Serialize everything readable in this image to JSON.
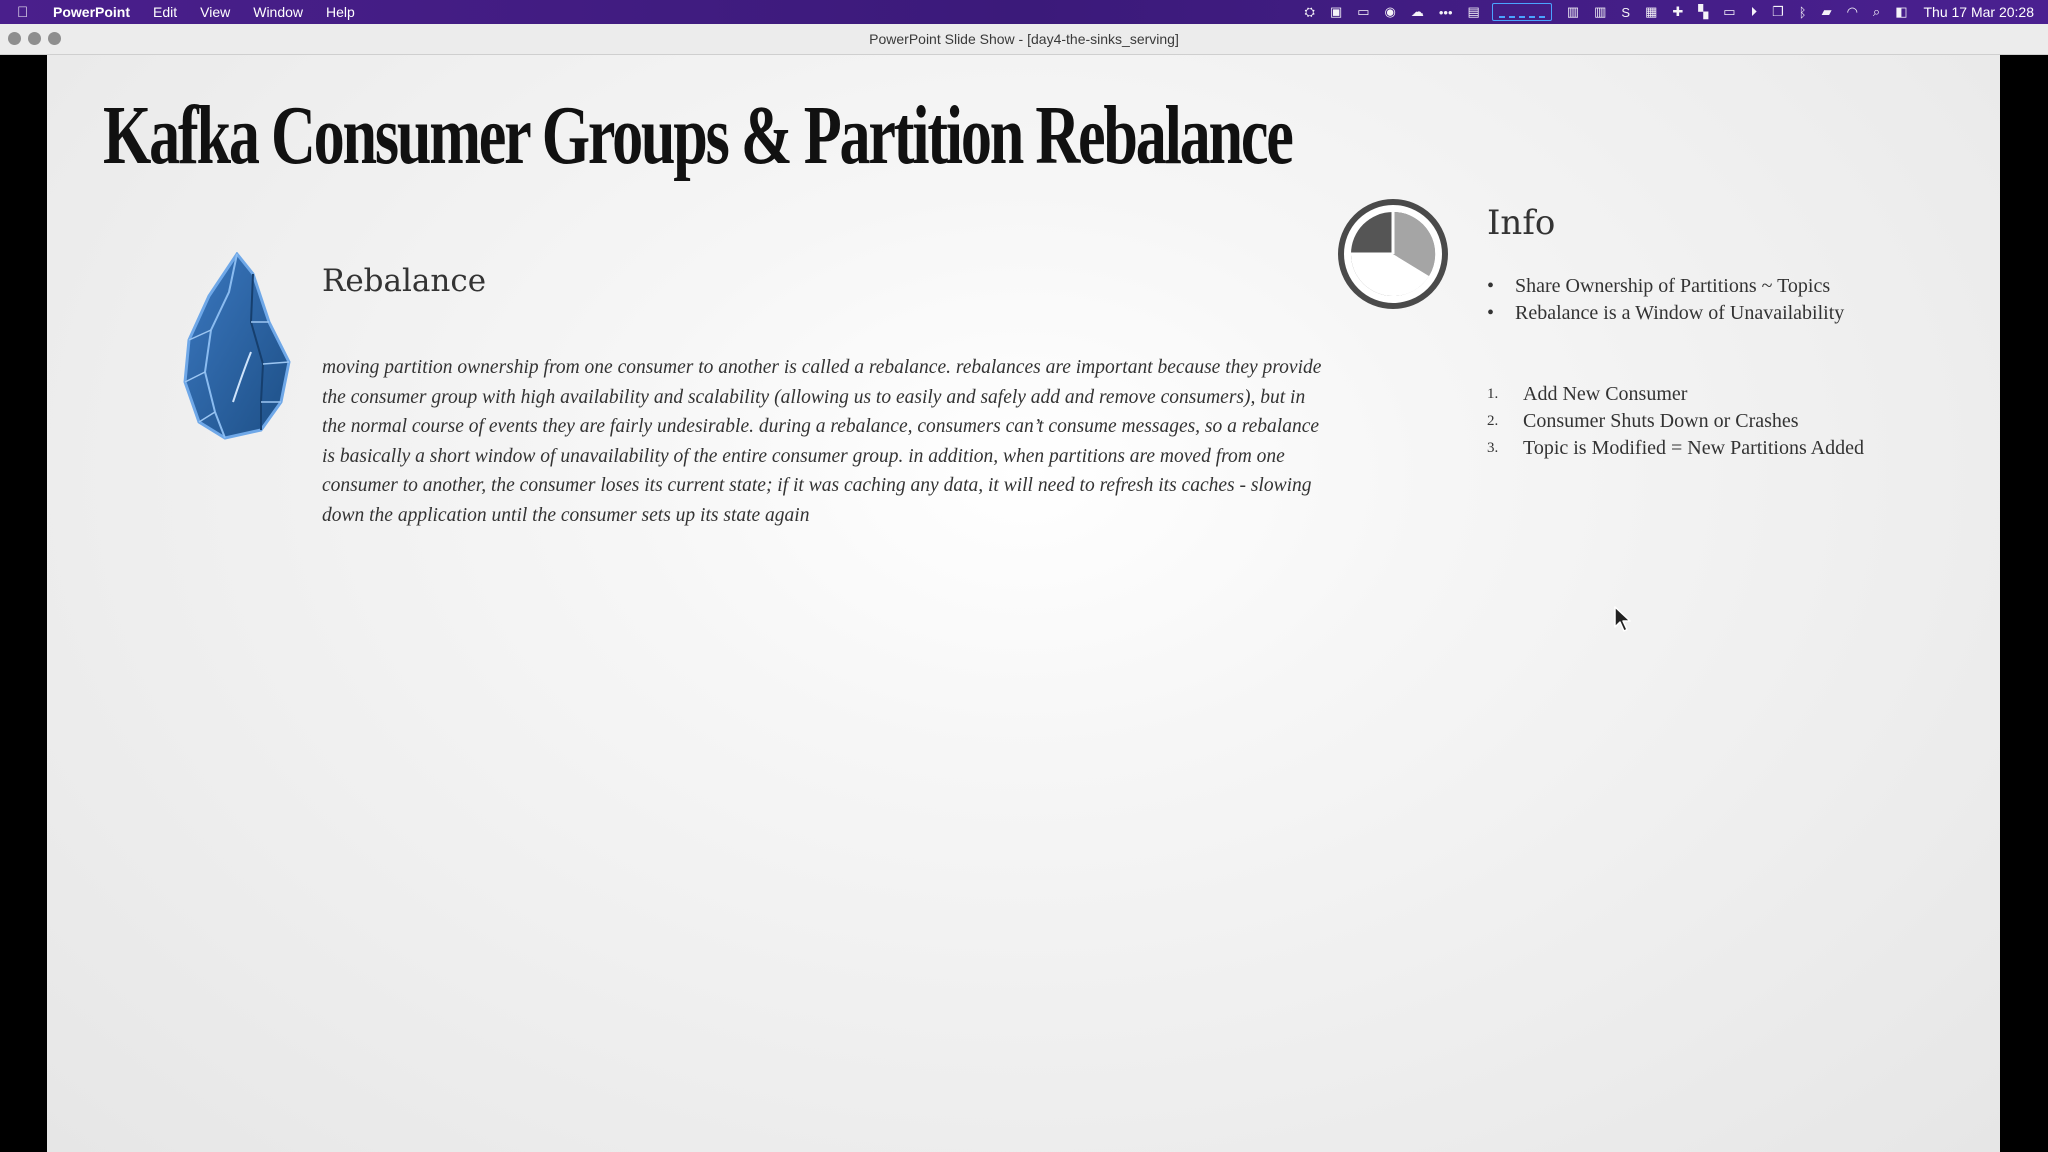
{
  "menubar": {
    "app_name": "PowerPoint",
    "items": [
      "Edit",
      "View",
      "Window",
      "Help"
    ],
    "clock": "Thu 17 Mar  20:28"
  },
  "window": {
    "title": "PowerPoint Slide Show - [day4-the-sinks_serving]"
  },
  "slide": {
    "title": "Kafka Consumer Groups & Partition Rebalance",
    "section_heading": "Rebalance",
    "paragraph": "moving partition ownership from one consumer to another is called a rebalance. rebalances are important because they provide the consumer group with high availability and scalability (allowing us to easily and safely add and remove consumers), but in the normal course of events they are fairly undesirable. during a rebalance, consumers can’t consume messages, so a rebalance is basically a short window of unavailability of the entire consumer group. in addition, when partitions are moved from one consumer to another, the consumer loses its current state; if it was caching any data, it will need to refresh its caches - slowing down the application until the consumer sets up its state again",
    "info_heading": "Info",
    "bullets": [
      "Share Ownership of Partitions ~ Topics",
      "Rebalance is a Window of Unavailability"
    ],
    "numbered": [
      {
        "num": "1.",
        "text": "Add New Consumer"
      },
      {
        "num": "2.",
        "text": "Consumer Shuts Down or Crashes"
      },
      {
        "num": "3.",
        "text": "Topic is Modified = New Partitions Added"
      }
    ]
  },
  "icons": {
    "crystal": "crystal-icon",
    "info": "info-circle-icon",
    "cursor": "mouse-cursor-icon"
  },
  "colors": {
    "menubar": "#4a1f8c",
    "crystal_blue": "#2e5f9a",
    "text": "#333333"
  }
}
